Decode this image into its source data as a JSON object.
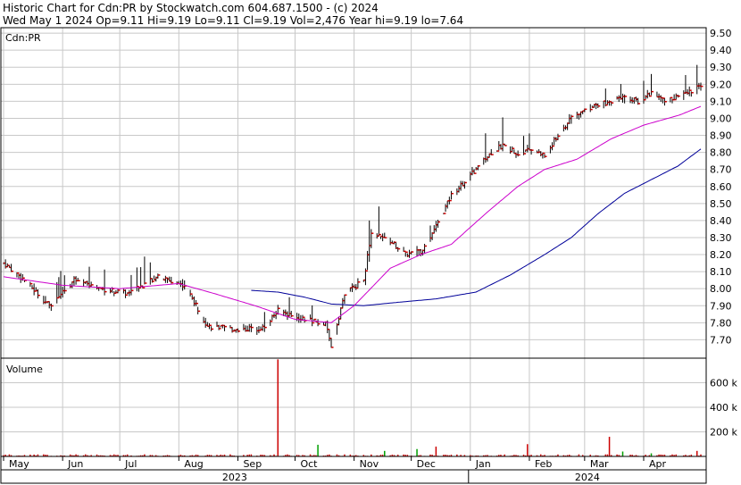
{
  "header": {
    "line1": "Historic Chart for Cdn:PR by Stockwatch.com 604.687.1500 - (c) 2024",
    "line2": "Wed May  1 2024   Op=9.11  Hi=9.19  Lo=9.11  Cl=9.19  Vol=2,476  Year hi=9.19  lo=7.64"
  },
  "colors": {
    "background": "#ffffff",
    "grid": "#c8c8c8",
    "bar_up": "#000000",
    "bar_close_tick": "#cc0000",
    "ma_short": "#cc00cc",
    "ma_long": "#000099",
    "volume": "#cc0000",
    "volume_up": "#00a000"
  },
  "chart_data": [
    {
      "type": "ohlc",
      "title": "Cdn:PR",
      "ylim": [
        7.6,
        9.55
      ],
      "y_ticks": [
        "9.50",
        "9.40",
        "9.30",
        "9.20",
        "9.10",
        "9.00",
        "8.90",
        "8.80",
        "8.70",
        "8.60",
        "8.50",
        "8.40",
        "8.30",
        "8.20",
        "8.10",
        "8.00",
        "7.90",
        "7.80",
        "7.70"
      ],
      "y_tick_values": [
        9.5,
        9.4,
        9.3,
        9.2,
        9.1,
        9.0,
        8.9,
        8.8,
        8.7,
        8.6,
        8.5,
        8.4,
        8.3,
        8.2,
        8.1,
        8.0,
        7.9,
        7.8,
        7.7
      ],
      "grid": true,
      "price_anchors": {
        "date": [
          "2023-05-01",
          "2023-05-12",
          "2023-05-25",
          "2023-06-07",
          "2023-06-21",
          "2023-07-06",
          "2023-07-20",
          "2023-08-04",
          "2023-08-16",
          "2023-08-31",
          "2023-09-14",
          "2023-09-22",
          "2023-10-06",
          "2023-10-17",
          "2023-10-20",
          "2023-10-27",
          "2023-11-06",
          "2023-11-10",
          "2023-11-20",
          "2023-11-28",
          "2023-12-06",
          "2023-12-14",
          "2023-12-22",
          "2024-01-04",
          "2024-01-12",
          "2024-01-19",
          "2024-01-26",
          "2024-02-02",
          "2024-02-09",
          "2024-02-16",
          "2024-02-23",
          "2024-03-01",
          "2024-03-08",
          "2024-03-15",
          "2024-03-22",
          "2024-03-29",
          "2024-04-05",
          "2024-04-12",
          "2024-04-19",
          "2024-04-26",
          "2024-05-01"
        ],
        "close": [
          8.15,
          8.05,
          7.9,
          8.05,
          8.0,
          7.97,
          8.07,
          8.02,
          7.78,
          7.76,
          7.77,
          7.87,
          7.82,
          7.79,
          7.66,
          7.97,
          8.05,
          8.32,
          8.28,
          8.2,
          8.22,
          8.36,
          8.55,
          8.7,
          8.8,
          8.85,
          8.78,
          8.82,
          8.78,
          8.9,
          9.0,
          9.05,
          9.08,
          9.1,
          9.12,
          9.1,
          9.15,
          9.1,
          9.13,
          9.16,
          9.19
        ]
      },
      "ma_short_anchors": {
        "date": [
          "2023-05-01",
          "2023-06-01",
          "2023-07-01",
          "2023-08-01",
          "2023-08-20",
          "2023-09-10",
          "2023-10-01",
          "2023-10-20",
          "2023-11-01",
          "2023-11-20",
          "2023-12-06",
          "2023-12-22",
          "2024-01-10",
          "2024-01-26",
          "2024-02-09",
          "2024-02-26",
          "2024-03-15",
          "2024-04-01",
          "2024-04-20",
          "2024-05-01"
        ],
        "value": [
          8.07,
          8.02,
          8.0,
          8.03,
          7.97,
          7.9,
          7.82,
          7.8,
          7.9,
          8.12,
          8.2,
          8.26,
          8.45,
          8.6,
          8.7,
          8.76,
          8.88,
          8.96,
          9.02,
          9.07
        ]
      },
      "ma_long_anchors": {
        "date": [
          "2023-09-08",
          "2023-09-22",
          "2023-10-06",
          "2023-10-20",
          "2023-11-06",
          "2023-11-24",
          "2023-12-14",
          "2024-01-04",
          "2024-01-22",
          "2024-02-09",
          "2024-02-23",
          "2024-03-08",
          "2024-03-22",
          "2024-04-05",
          "2024-04-19",
          "2024-05-01"
        ],
        "value": [
          7.99,
          7.98,
          7.95,
          7.91,
          7.9,
          7.92,
          7.94,
          7.98,
          8.08,
          8.2,
          8.3,
          8.44,
          8.56,
          8.64,
          8.72,
          8.82
        ]
      },
      "legend": "none"
    },
    {
      "type": "bar",
      "title": "Volume",
      "ylim": [
        0,
        800000
      ],
      "y_ticks": [
        "600 k",
        "400 k",
        "200 k"
      ],
      "y_tick_values": [
        600000,
        400000,
        200000
      ],
      "grid": true,
      "spikes": {
        "date": [
          "2023-09-22",
          "2023-10-13",
          "2023-11-17",
          "2023-12-04",
          "2023-12-14",
          "2024-01-31",
          "2024-03-14",
          "2024-03-21",
          "2024-04-05",
          "2024-04-29"
        ],
        "value": [
          790000,
          95000,
          45000,
          60000,
          80000,
          100000,
          160000,
          40000,
          25000,
          45000
        ]
      }
    }
  ],
  "x_axis": {
    "months": [
      "May",
      "Jun",
      "Jul",
      "Aug",
      "Sep",
      "Oct",
      "Nov",
      "Dec",
      "Jan",
      "Feb",
      "Mar",
      "Apr"
    ],
    "month_dates": [
      "2023-05-01",
      "2023-06-01",
      "2023-07-01",
      "2023-08-01",
      "2023-09-01",
      "2023-10-01",
      "2023-11-01",
      "2023-12-01",
      "2024-01-01",
      "2024-02-01",
      "2024-03-01",
      "2024-04-01"
    ],
    "years": [
      "2023",
      "2024"
    ],
    "year_dates": [
      "2023-01-01",
      "2024-01-01"
    ],
    "range": [
      "2023-05-01",
      "2024-05-01"
    ]
  }
}
